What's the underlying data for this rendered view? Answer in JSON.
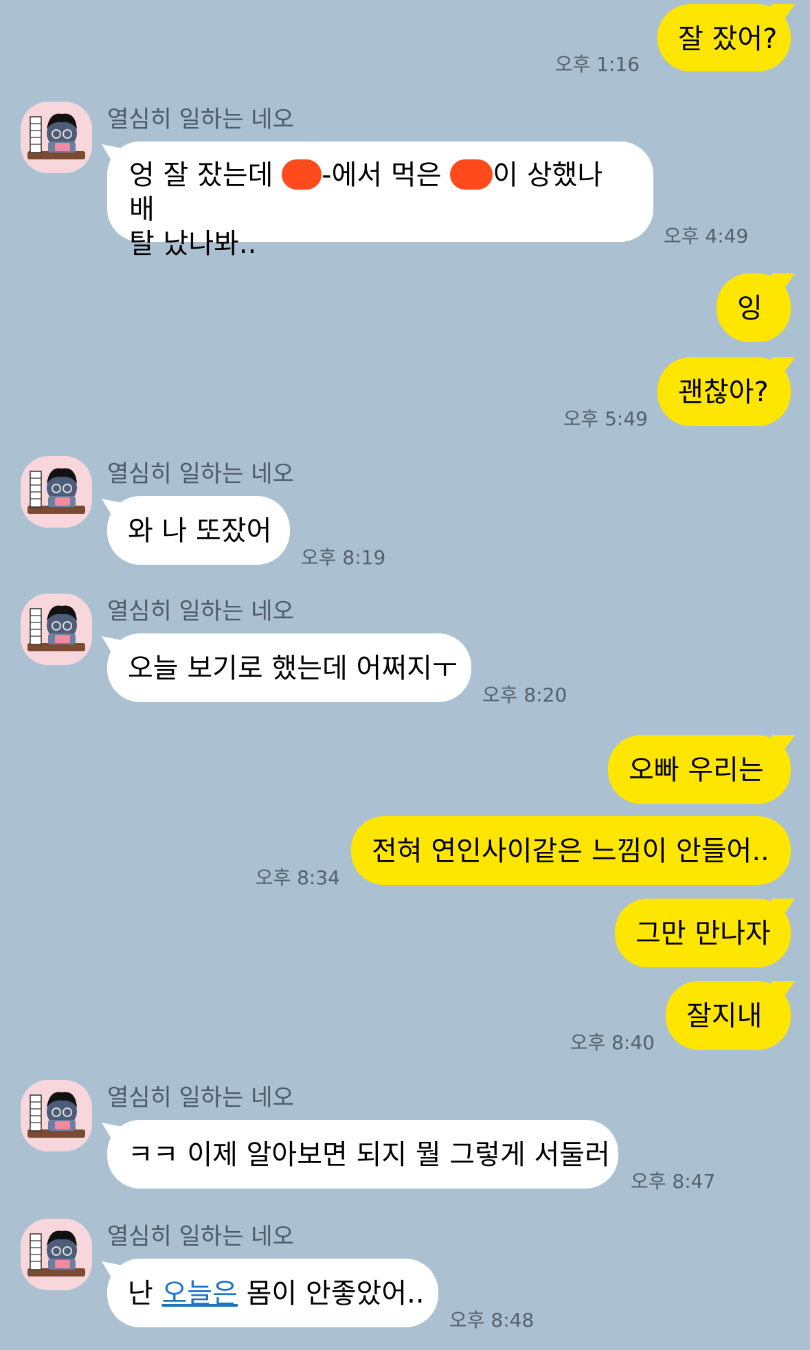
{
  "messages": [
    {
      "id": "m1",
      "side": "me",
      "text": "잘 잤어?",
      "time": "오후 1:16"
    },
    {
      "id": "m2",
      "side": "them",
      "sender": "열심히 일하는 네오",
      "line1_a": "엉 잘 잤는데 ",
      "line1_b": "-에서 먹은 ",
      "line1_c": "이 상했나 배",
      "line2": "탈 났나봐..",
      "time": "오후 4:49"
    },
    {
      "id": "m3",
      "side": "me",
      "text": "잉"
    },
    {
      "id": "m4",
      "side": "me",
      "text": "괜찮아?",
      "time": "오후 5:49"
    },
    {
      "id": "m5",
      "side": "them",
      "sender": "열심히 일하는 네오",
      "text": "와 나 또잤어",
      "time": "오후 8:19"
    },
    {
      "id": "m6",
      "side": "them",
      "sender": "열심히 일하는 네오",
      "text": "오늘 보기로 했는데 어쩌지ㅜ",
      "time": "오후 8:20"
    },
    {
      "id": "m7",
      "side": "me",
      "text": "오빠 우리는"
    },
    {
      "id": "m8",
      "side": "me",
      "text": "전혀 연인사이같은 느낌이 안들어..",
      "time": "오후 8:34"
    },
    {
      "id": "m9",
      "side": "me",
      "text": "그만 만나자"
    },
    {
      "id": "m10",
      "side": "me",
      "text": "잘지내",
      "time": "오후 8:40"
    },
    {
      "id": "m11",
      "side": "them",
      "sender": "열심히 일하는 네오",
      "text": "ㅋㅋ 이제 알아보면 되지 뭘 그렇게 서둘러",
      "time": "오후 8:47"
    },
    {
      "id": "m12",
      "side": "them",
      "sender": "열심히 일하는 네오",
      "text_a": "난 ",
      "link": "오늘은",
      "text_b": " 몸이 안좋았어..",
      "time": "오후 8:48"
    }
  ],
  "colors": {
    "background": "#abc1d1",
    "my_bubble": "#ffe600",
    "their_bubble": "#ffffff",
    "redaction": "#ff4a1c",
    "link": "#1c74c4"
  },
  "icons": {
    "avatar": "neo-avatar-icon"
  }
}
